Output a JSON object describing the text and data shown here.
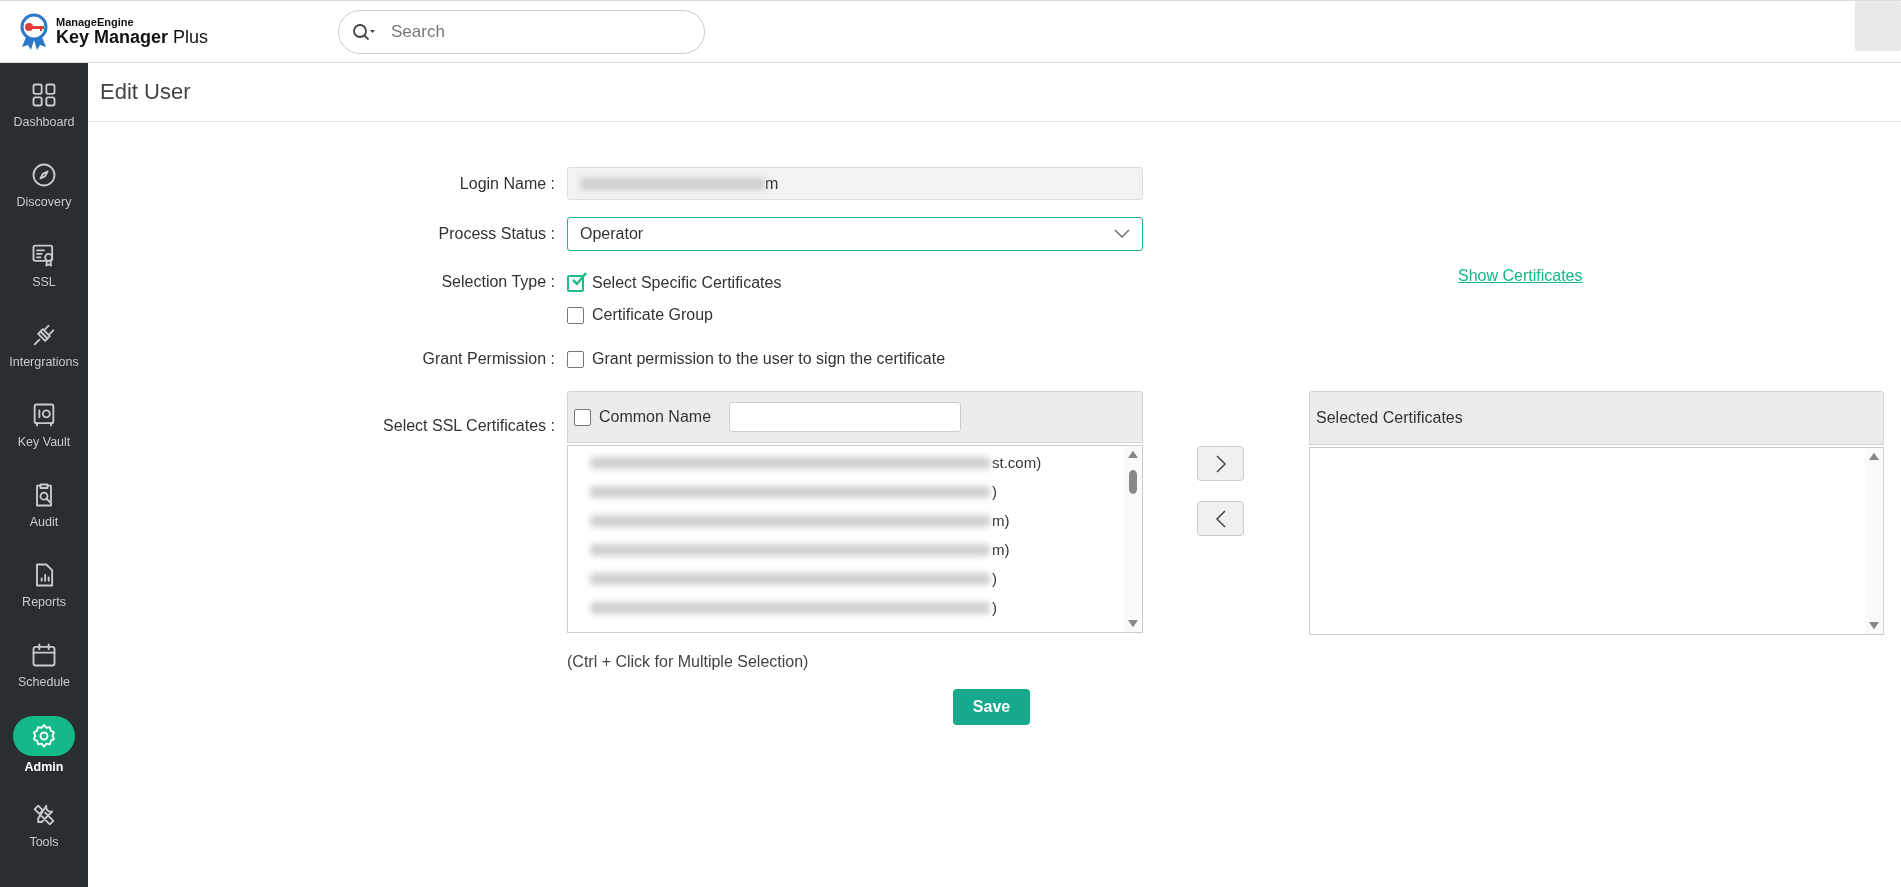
{
  "header": {
    "brand_top": "ManageEngine",
    "brand_name": "Key Manager",
    "brand_suffix": "Plus",
    "search": {
      "placeholder": "Search"
    }
  },
  "sidebar": {
    "items": [
      {
        "label": "Dashboard",
        "selected": false
      },
      {
        "label": "Discovery",
        "selected": false
      },
      {
        "label": "SSL",
        "selected": false
      },
      {
        "label": "Intergrations",
        "selected": false
      },
      {
        "label": "Key Vault",
        "selected": false
      },
      {
        "label": "Audit",
        "selected": false
      },
      {
        "label": "Reports",
        "selected": false
      },
      {
        "label": "Schedule",
        "selected": false
      },
      {
        "label": "Admin",
        "selected": true
      },
      {
        "label": "Tools",
        "selected": false
      }
    ]
  },
  "page": {
    "title": "Edit User"
  },
  "form": {
    "login_name": {
      "label": "Login Name :",
      "value": "m"
    },
    "process_status": {
      "label": "Process Status :",
      "value": "Operator"
    },
    "selection_type": {
      "label": "Selection Type :",
      "options": [
        {
          "label": "Select Specific Certificates",
          "checked": true
        },
        {
          "label": "Certificate Group",
          "checked": false
        }
      ]
    },
    "show_certificates": "Show Certificates",
    "grant_permission": {
      "label": "Grant Permission :",
      "option": {
        "label": "Grant permission to the user to sign the certificate",
        "checked": false
      }
    },
    "ssl_certificates": {
      "label": "Select SSL Certificates :",
      "header_checkbox": {
        "label": "Common Name",
        "checked": false
      },
      "items": [
        {
          "text": "st.com)"
        },
        {
          "text": ")"
        },
        {
          "text": "m)"
        },
        {
          "text": "m)"
        },
        {
          "text": ")"
        },
        {
          "text": ")"
        }
      ]
    },
    "selected_certificates": {
      "title": "Selected Certificates"
    },
    "hint": "(Ctrl + Click for Multiple Selection)",
    "save": "Save"
  }
}
